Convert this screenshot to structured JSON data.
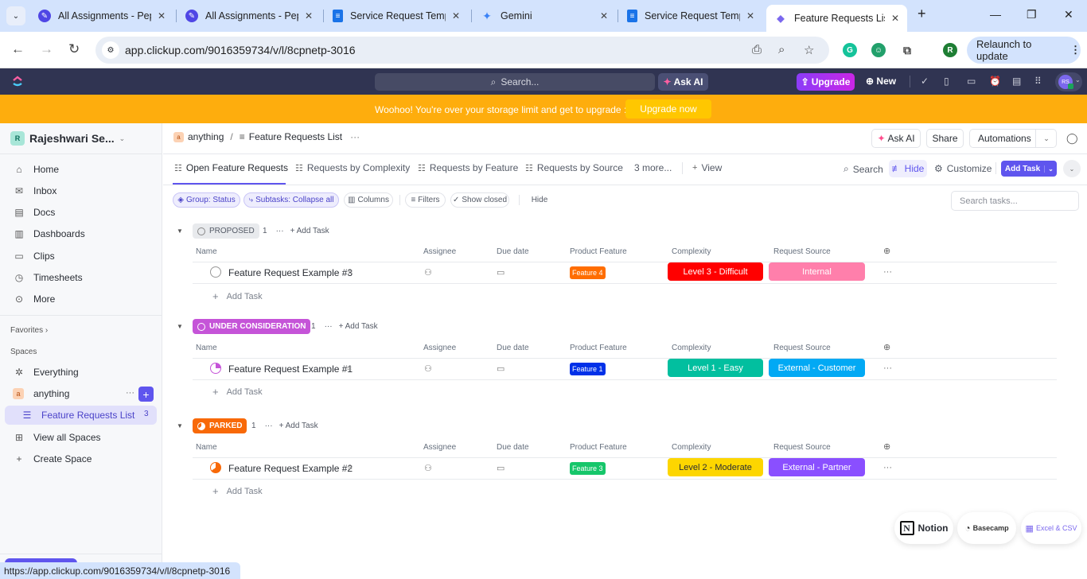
{
  "browser": {
    "tabs": [
      {
        "title": "All Assignments - Pep",
        "icon": "pepper-icon",
        "color": "#4f46e5"
      },
      {
        "title": "All Assignments - Pep",
        "icon": "pepper-icon",
        "color": "#4f46e5"
      },
      {
        "title": "Service Request Temp",
        "icon": "google-docs-icon",
        "color": "#1a73e8"
      },
      {
        "title": "Gemini",
        "icon": "gemini-icon",
        "color": "#3b82f6"
      },
      {
        "title": "Service Request Temp",
        "icon": "google-docs-icon",
        "color": "#1a73e8"
      },
      {
        "title": "Feature Requests List",
        "icon": "clickup-icon",
        "color": "#7b68ee",
        "active": true
      }
    ],
    "url": "app.clickup.com/9016359734/v/l/8cpnetp-3016",
    "profile_initial": "R",
    "relaunch_label": "Relaunch to update",
    "status_url": "https://app.clickup.com/9016359734/v/l/8cpnetp-3016"
  },
  "topbar": {
    "search_placeholder": "Search...",
    "ask_ai": "Ask AI",
    "upgrade": "Upgrade",
    "new": "New",
    "avatar_initials": "RS"
  },
  "banner": {
    "text": "Woohoo! You're over your storage limit and get to upgrade :)",
    "button": "Upgrade now"
  },
  "sidebar": {
    "workspace_initial": "R",
    "workspace_name": "Rajeshwari Se...",
    "nav": [
      {
        "label": "Home",
        "icon": "home-icon"
      },
      {
        "label": "Inbox",
        "icon": "inbox-icon"
      },
      {
        "label": "Docs",
        "icon": "docs-icon"
      },
      {
        "label": "Dashboards",
        "icon": "dashboards-icon"
      },
      {
        "label": "Clips",
        "icon": "clips-icon"
      },
      {
        "label": "Timesheets",
        "icon": "timesheets-icon"
      },
      {
        "label": "More",
        "icon": "more-icon"
      }
    ],
    "favorites": "Favorites",
    "spaces_label": "Spaces",
    "everything": "Everything",
    "space_initial": "a",
    "space_name": "anything",
    "list_name": "Feature Requests List",
    "list_count": "3",
    "view_all_spaces": "View all Spaces",
    "create_space": "Create Space"
  },
  "header": {
    "breadcrumb_space_initial": "a",
    "breadcrumb_space": "anything",
    "breadcrumb_sep": "/",
    "breadcrumb_list": "Feature Requests List",
    "ask_ai": "Ask AI",
    "share": "Share",
    "automations": "Automations"
  },
  "views": {
    "tabs": [
      "Open Feature Requests",
      "Requests by Complexity",
      "Requests by Feature",
      "Requests by Source"
    ],
    "more": "3 more...",
    "add_view": "View",
    "search": "Search",
    "hide": "Hide",
    "customize": "Customize",
    "add_task": "Add Task"
  },
  "toolbar": {
    "group": "Group: Status",
    "subtasks": "Subtasks: Collapse all",
    "columns": "Columns",
    "filters": "Filters",
    "show_closed": "Show closed",
    "hide": "Hide",
    "search_placeholder": "Search tasks..."
  },
  "columns": [
    "Name",
    "Assignee",
    "Due date",
    "Product Feature",
    "Complexity",
    "Request Source"
  ],
  "add_task_label": "Add Task",
  "groups": [
    {
      "status": "PROPOSED",
      "count": "1",
      "bg": "#e8eaed",
      "fg": "#545a66",
      "tasks": [
        {
          "name": "Feature Request Example #3",
          "feature": "Feature 4",
          "feature_color": "#ff6d00",
          "complexity": "Level 3 - Difficult",
          "complexity_bg": "#ff0000",
          "complexity_fg": "#ffffff",
          "source": "Internal",
          "source_bg": "#ff7fab"
        }
      ]
    },
    {
      "status": "UNDER CONSIDERATION",
      "count": "1",
      "bg": "#c554d8",
      "fg": "#ffffff",
      "tasks": [
        {
          "name": "Feature Request Example #1",
          "feature": "Feature 1",
          "feature_color": "#0231e8",
          "complexity": "Level 1 - Easy",
          "complexity_bg": "#02bf9f",
          "complexity_fg": "#ffffff",
          "source": "External - Customer",
          "source_bg": "#02a9f4"
        }
      ]
    },
    {
      "status": "PARKED",
      "count": "1",
      "bg": "#f86908",
      "fg": "#ffffff",
      "tasks": [
        {
          "name": "Feature Request Example #2",
          "feature": "Feature 3",
          "feature_color": "#16c66a",
          "complexity": "Level 2 - Moderate",
          "complexity_bg": "#fdd600",
          "complexity_fg": "#292d34",
          "source": "External - Partner",
          "source_bg": "#8a4fff"
        }
      ]
    }
  ],
  "imports": [
    "Notion",
    "Basecamp",
    "Excel & CSV"
  ]
}
